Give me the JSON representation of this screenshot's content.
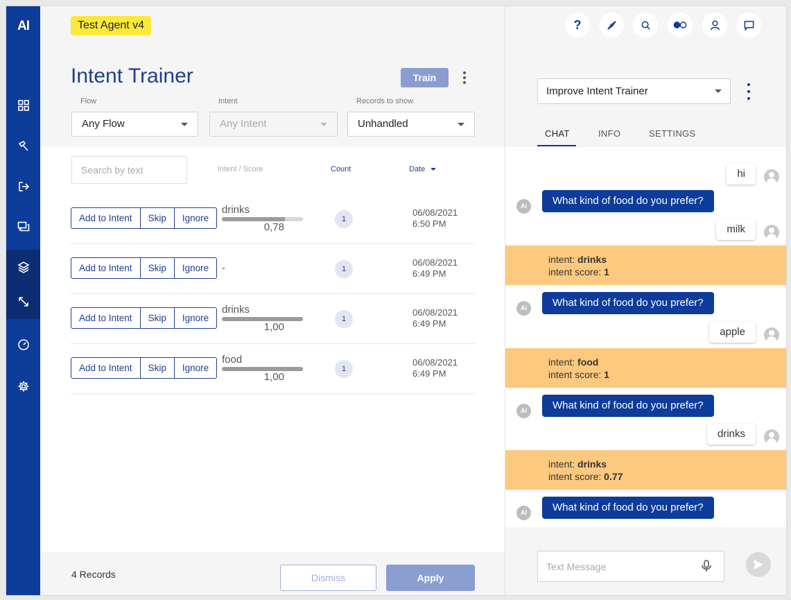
{
  "nav": {
    "logo": "AI",
    "items": [
      {
        "icon": "grid-icon"
      },
      {
        "icon": "wand-icon"
      },
      {
        "icon": "logout-icon"
      },
      {
        "icon": "chat-bubbles-icon"
      },
      {
        "icon": "layers-icon"
      },
      {
        "icon": "resize-icon"
      },
      {
        "icon": "gauge-icon"
      },
      {
        "icon": "gear-icon"
      }
    ]
  },
  "main": {
    "agent_name": "Test Agent v4",
    "title": "Intent Trainer",
    "train_label": "Train",
    "filters": {
      "flow_label": "Flow",
      "flow_value": "Any Flow",
      "intent_label": "Intent",
      "intent_value": "Any Intent",
      "records_label": "Records to show",
      "records_value": "Unhandled"
    },
    "search_placeholder": "Search by text",
    "columns": {
      "intent_score": "Intent / Score",
      "count": "Count",
      "date": "Date"
    },
    "row_actions": {
      "add": "Add to Intent",
      "skip": "Skip",
      "ignore": "Ignore"
    },
    "rows": [
      {
        "intent": "drinks",
        "score": "0,78",
        "score_frac": 0.78,
        "count": "1",
        "date": "06/08/2021",
        "time": "6:50 PM"
      },
      {
        "intent": "-",
        "score": "",
        "score_frac": 0,
        "count": "1",
        "date": "06/08/2021",
        "time": "6:49 PM"
      },
      {
        "intent": "drinks",
        "score": "1,00",
        "score_frac": 1.0,
        "count": "1",
        "date": "06/08/2021",
        "time": "6:49 PM"
      },
      {
        "intent": "food",
        "score": "1,00",
        "score_frac": 1.0,
        "count": "1",
        "date": "06/08/2021",
        "time": "6:49 PM"
      }
    ],
    "footer": {
      "records": "4 Records",
      "dismiss": "Dismiss",
      "apply": "Apply"
    }
  },
  "chat": {
    "top_icons": [
      "help-icon",
      "compass-icon",
      "search-icon",
      "toggle-icon",
      "user-icon",
      "message-icon"
    ],
    "help_label": "?",
    "mode_select": "Improve Intent Trainer",
    "tabs": [
      "CHAT",
      "INFO",
      "SETTINGS"
    ],
    "active_tab": "CHAT",
    "bot_avatar_label": "AI",
    "messages": {
      "u1": "hi",
      "b1": "What kind of food do you prefer?",
      "u2": "milk",
      "i1_label": "intent:",
      "i1_value": "drinks",
      "i1_score_label": "intent score:",
      "i1_score": "1",
      "b2": "What kind of food do you prefer?",
      "u3": "apple",
      "i2_label": "intent:",
      "i2_value": "food",
      "i2_score_label": "intent score:",
      "i2_score": "1",
      "b3": "What kind of food do you prefer?",
      "u4": "drinks",
      "i3_label": "intent:",
      "i3_value": "drinks",
      "i3_score_label": "intent score:",
      "i3_score": "0.77",
      "b4": "What kind of food do you prefer?"
    },
    "input_placeholder": "Text Message"
  },
  "colors": {
    "primary": "#0d3c9a",
    "badge": "#fde83a",
    "intent_band": "#fdc97e",
    "button_muted": "#8a9dd0"
  }
}
